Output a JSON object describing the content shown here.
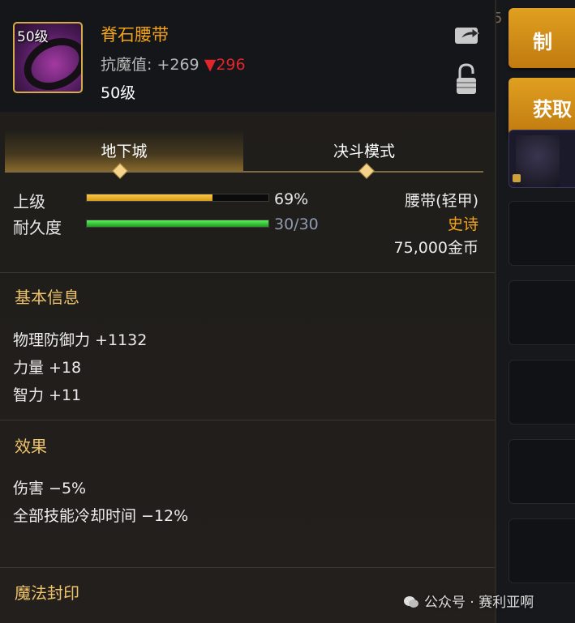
{
  "sidebar": {
    "top_glyph": "5",
    "make_button": "制",
    "obtain_button": "获取"
  },
  "item": {
    "level_badge": "50级",
    "name": "脊石腰带",
    "resist_label": "抗魔值:",
    "resist_value": "+269",
    "resist_down_arrow": "▼",
    "resist_down": "296",
    "level": "50级"
  },
  "tabs": [
    {
      "label": "地下城",
      "active": true
    },
    {
      "label": "决斗模式",
      "active": false
    }
  ],
  "progress": {
    "upgrade_label": "上级",
    "upgrade_percent": 69,
    "upgrade_text": "69%",
    "durability_label": "耐久度",
    "durability_current": 30,
    "durability_max": 30,
    "durability_text": "30/30"
  },
  "meta": {
    "type": "腰带(轻甲)",
    "rarity": "史诗",
    "price": "75,000金币"
  },
  "sections": {
    "basic": {
      "title": "基本信息",
      "stats": [
        "物理防御力 +1132",
        "力量 +18",
        "智力 +11"
      ]
    },
    "effects": {
      "title": "效果",
      "stats": [
        "伤害 −5%",
        "全部技能冷却时间 −12%"
      ]
    },
    "seal": {
      "title": "魔法封印"
    }
  },
  "watermark": "公众号 · 赛利亚啊",
  "colors": {
    "gold": "#f3a31b",
    "epic": "#f3a31b",
    "upgrade_bar": "#f0b52a",
    "durability_bar": "#3bd03b",
    "resist_down": "#e0262b",
    "section_title": "#efc46a"
  },
  "icons": {
    "share": "share-icon",
    "lock": "lock-icon",
    "item": "belt-item-icon",
    "wechat": "wechat-icon"
  }
}
